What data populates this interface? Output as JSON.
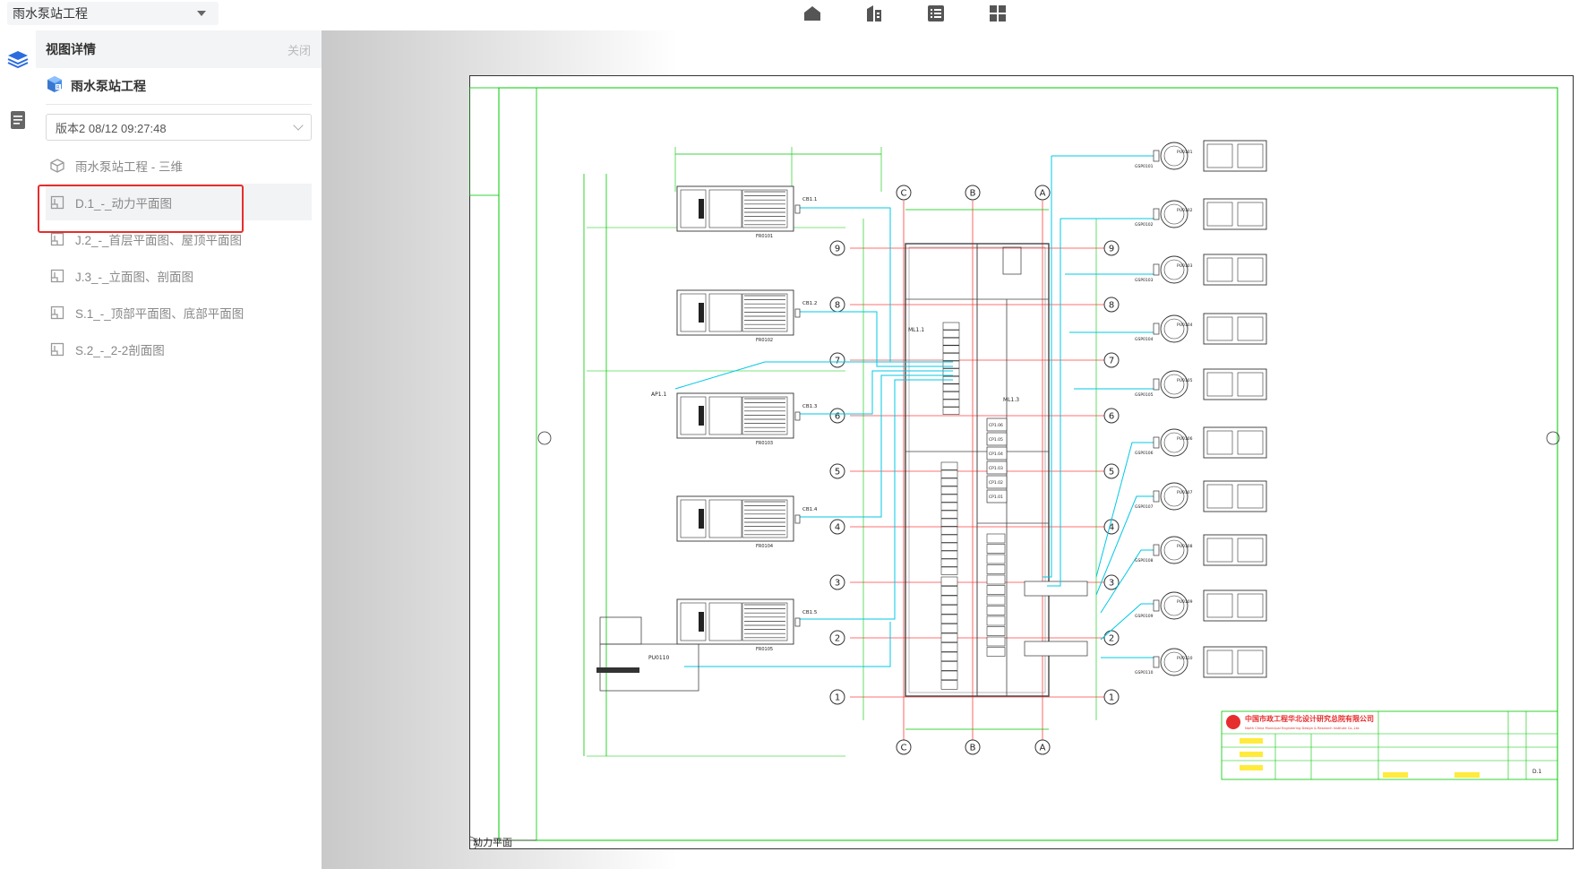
{
  "topbar": {
    "project_select": "雨水泵站工程",
    "icons": [
      "home-icon",
      "building-icon",
      "list-icon",
      "grid-icon"
    ]
  },
  "rail": {
    "icons": [
      "layers-icon",
      "document-icon"
    ]
  },
  "panel": {
    "title": "视图详情",
    "close_label": "关闭",
    "project_name": "雨水泵站工程",
    "version": "版本2 08/12 09:27:48",
    "views": [
      {
        "label": "雨水泵站工程 - 三维",
        "icon": "cube-icon"
      },
      {
        "label": "D.1_-_动力平面图",
        "icon": "drawing-sheet-icon",
        "active": true
      },
      {
        "label": "J.2_-_首层平面图、屋顶平面图",
        "icon": "drawing-sheet-icon"
      },
      {
        "label": "J.3_-_立面图、剖面图",
        "icon": "drawing-sheet-icon"
      },
      {
        "label": "S.1_-_顶部平面图、底部平面图",
        "icon": "drawing-sheet-icon"
      },
      {
        "label": "S.2_-_2-2剖面图",
        "icon": "drawing-sheet-icon"
      }
    ]
  },
  "drawing": {
    "axis_columns": [
      "C",
      "B",
      "A"
    ],
    "axis_rows": [
      "9",
      "8",
      "7",
      "6",
      "5",
      "4",
      "3",
      "2",
      "1"
    ],
    "fan_labels": [
      "CB1.1",
      "CB1.2",
      "CB1.3",
      "CB1.4",
      "CB1.5"
    ],
    "fan_tags": [
      "FR0101",
      "FR0102",
      "FR0103",
      "FR0104",
      "FR0105"
    ],
    "pump_tags": [
      "PU0101",
      "PU0102",
      "PU0103",
      "PU0104",
      "PU0105",
      "PU0106",
      "PU0107",
      "PU0108",
      "PU0109",
      "PU0110"
    ],
    "pump_box_tags": [
      "GSP0101",
      "GSP0102",
      "GSP0103",
      "GSP0104",
      "GSP0105",
      "GSP0106",
      "GSP0107",
      "GSP0108",
      "GSP0109",
      "GSP0110"
    ],
    "cabinet_tags": [
      "CP1.06",
      "CP1.05",
      "CP1.04",
      "CP1.03",
      "CP1.02",
      "CP1.01"
    ],
    "misc_labels": [
      "AP1.1",
      "PU0110",
      "ML1.1",
      "ML1.3"
    ],
    "title_block": {
      "company": "中国市政工程华北设计研究总院有限公司",
      "company_en": "North China Municipal Engineering Design & Research Institute Co.,Ltd.",
      "sheet_no": "D.1"
    },
    "footer_label": "动力平面"
  },
  "colors": {
    "accent": "#2d6cdf",
    "highlight": "#e62e2e",
    "cad_green": "#00c800",
    "cad_cyan": "#00c8e6",
    "cad_red": "#ff4040"
  }
}
